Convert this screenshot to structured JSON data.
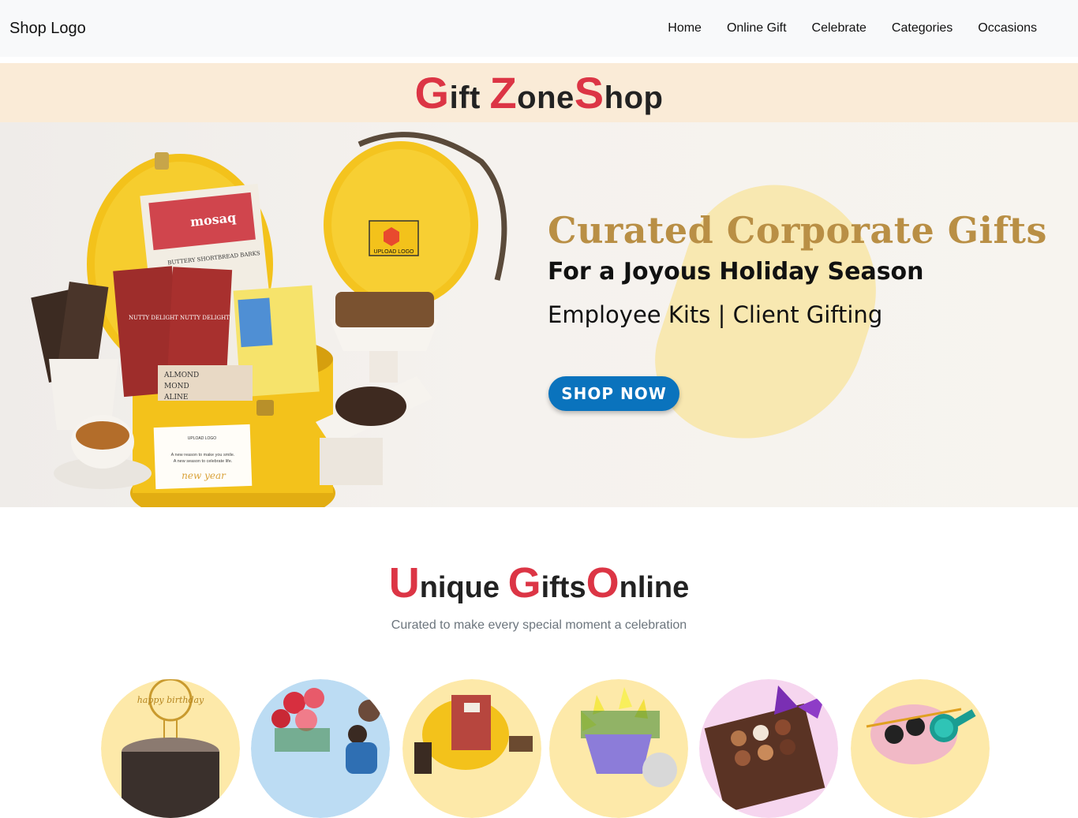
{
  "navbar": {
    "brand": "Shop Logo",
    "links": [
      "Home",
      "Online Gift",
      "Celebrate",
      "Categories",
      "Occasions"
    ]
  },
  "site_title": {
    "c1": "G",
    "r1": "ift ",
    "c2": "Z",
    "r2": "one",
    "c3": "S",
    "r3": "hop"
  },
  "hero": {
    "headline": "Curated Corporate Gifts",
    "subheadline": "For a Joyous Holiday Season",
    "tagline": "Employee Kits | Client Gifting",
    "button_label": "SHOP NOW",
    "card_label": "UPLOAD LOGO",
    "card_line1": "A new reason to make you smile.",
    "card_line2": "A new season to celebrate life.",
    "card_script": "new year",
    "box_label": "UPLOAD LOGO",
    "pack_brand": "mosaq",
    "pack1_name": "BUTTERY SHORTBREAD BARKS",
    "pack2_name": "NUTTY DELIGHT",
    "pack3_name": "NUTTY DELIGHT",
    "pack_left1": "ALMOND",
    "pack_left2": "MOND",
    "pack_left3": "ALINE"
  },
  "section": {
    "c1": "U",
    "r1": "nique ",
    "c2": "G",
    "r2": "ifts",
    "c3": "O",
    "r3": "nline",
    "subtitle": "Curated to make every special moment a celebration"
  },
  "categories": [
    {
      "icon": "birthday-cake-icon",
      "topper": "happy birthday"
    },
    {
      "icon": "personalised-gift-icon"
    },
    {
      "icon": "hamper-icon"
    },
    {
      "icon": "flowers-icon"
    },
    {
      "icon": "chocolates-icon"
    },
    {
      "icon": "accessories-icon"
    }
  ],
  "colors": {
    "accent_red": "#dc3545",
    "nav_bg": "#f8f9fa",
    "title_band": "#faebd7",
    "hero_gold": "#b98f45",
    "button_blue": "#0a73bd"
  }
}
